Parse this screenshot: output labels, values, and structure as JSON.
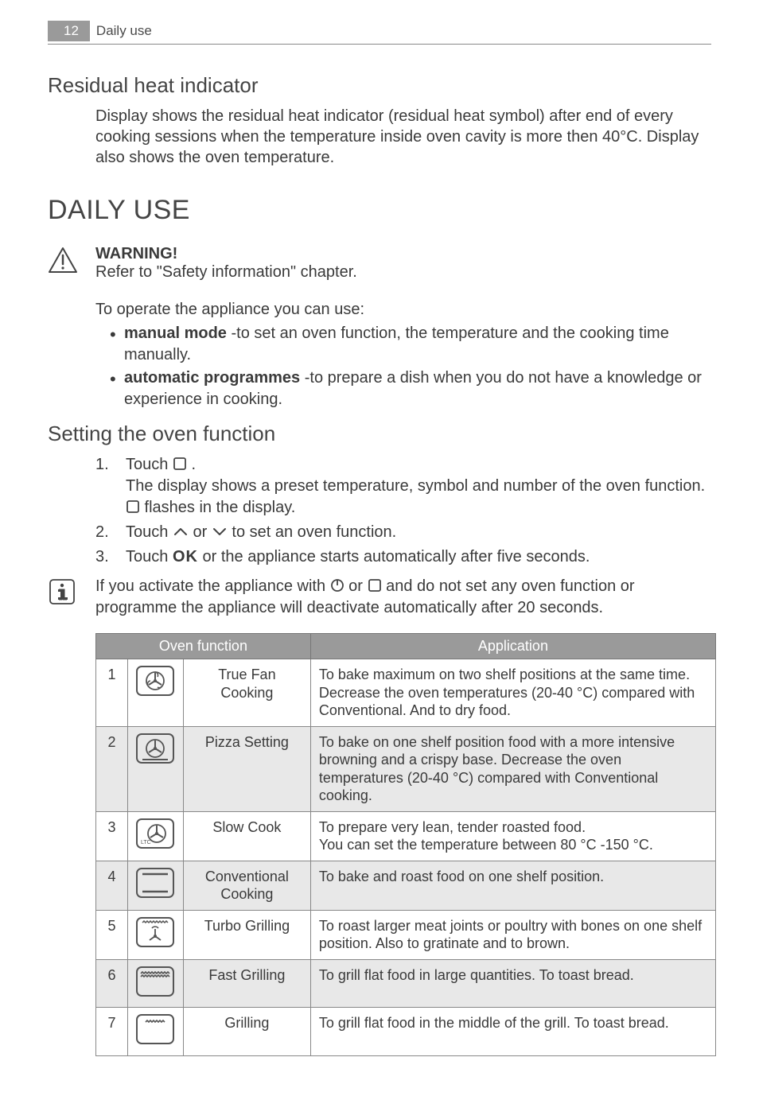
{
  "header": {
    "page_number": "12",
    "section": "Daily use"
  },
  "residual": {
    "title": "Residual heat indicator",
    "para": "Display shows the residual heat indicator (residual heat symbol) after end of every cooking sessions when the temperature inside oven cavity is more then 40°C. Display also shows the oven temperature."
  },
  "daily": {
    "title": "DAILY USE",
    "warning_label": "WARNING!",
    "warning_text": "Refer to \"Safety information\" chapter.",
    "operate_intro": "To operate the appliance you can use:",
    "bullets": [
      {
        "bold": "manual mode",
        "rest": " -to set an oven function, the temperature and the cooking time manually."
      },
      {
        "bold": "automatic programmes",
        "rest": " -to prepare a dish when you do not have a knowledge or experience in cooking."
      }
    ]
  },
  "setting": {
    "title": "Setting the oven function",
    "steps": [
      {
        "n": "1.",
        "pre": "Touch ",
        "after": " .",
        "sub": "The display shows a preset temperature, symbol and number of the oven function. ",
        "sub2": " flashes in the display."
      },
      {
        "n": "2.",
        "pre": "Touch ",
        "mid": " or ",
        "after": " to set an oven function."
      },
      {
        "n": "3.",
        "pre": "Touch ",
        "ok": "OK",
        "after": " or the appliance starts automatically after five seconds."
      }
    ],
    "info_pre": "If you activate the appliance with ",
    "info_mid": " or ",
    "info_after": " and do not set any oven function or programme the appliance will deactivate automatically after 20 seconds."
  },
  "table": {
    "headers": {
      "fn": "Oven function",
      "app": "Application"
    },
    "rows": [
      {
        "n": "1",
        "name": "True Fan Cooking",
        "app": "To bake maximum on two shelf positions at the same time. Decrease the oven temperatures (20-40 °C) compared with Conventional. And to dry food.",
        "shade": false,
        "icon": "fan"
      },
      {
        "n": "2",
        "name": "Pizza Setting",
        "app": "To bake on one shelf position food with a more intensive browning and a crispy base. Decrease the oven temperatures (20-40 °C) compared with Conventional cooking.",
        "shade": true,
        "icon": "pizza"
      },
      {
        "n": "3",
        "name": "Slow Cook",
        "app": "To prepare very lean, tender roasted food.\nYou can set the temperature between 80 °C -150 °C.",
        "shade": false,
        "icon": "slow"
      },
      {
        "n": "4",
        "name": "Conventional Cooking",
        "app": "To bake and roast food on one shelf position.",
        "shade": true,
        "icon": "conventional"
      },
      {
        "n": "5",
        "name": "Turbo Grilling",
        "app": "To roast larger meat joints or poultry with bones on one shelf position. Also to gratinate and to brown.",
        "shade": false,
        "icon": "turbo"
      },
      {
        "n": "6",
        "name": "Fast Grilling",
        "app": "To grill flat food in large quantities. To toast bread.",
        "shade": true,
        "icon": "fastgrill"
      },
      {
        "n": "7",
        "name": "Grilling",
        "app": "To grill flat food in the middle of the grill. To toast bread.",
        "shade": false,
        "icon": "grill"
      }
    ]
  }
}
